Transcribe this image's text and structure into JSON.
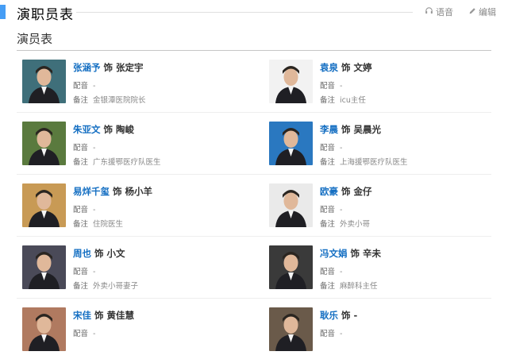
{
  "section": {
    "title": "演职员表",
    "voice_label": "语音",
    "edit_label": "编辑"
  },
  "cast_table": {
    "title": "演员表",
    "dub_label": "配音",
    "note_label": "备注",
    "role_connector": "饰",
    "items": [
      {
        "actor": "张涵予",
        "role": "张定宇",
        "dub": "-",
        "note": "金银潭医院院长",
        "photo_bg": "#3f6f7a"
      },
      {
        "actor": "袁泉",
        "role": "文婷",
        "dub": "-",
        "note": "icu主任",
        "photo_bg": "#f2f2f2"
      },
      {
        "actor": "朱亚文",
        "role": "陶峻",
        "dub": "-",
        "note": "广东援鄂医疗队医生",
        "photo_bg": "#5a7a3e"
      },
      {
        "actor": "李晨",
        "role": "吴晨光",
        "dub": "-",
        "note": "上海援鄂医疗队医生",
        "photo_bg": "#2a78c0"
      },
      {
        "actor": "易烊千玺",
        "role": "杨小羊",
        "dub": "-",
        "note": "住院医生",
        "photo_bg": "#c89a55"
      },
      {
        "actor": "欧豪",
        "role": "金仔",
        "dub": "-",
        "note": "外卖小哥",
        "photo_bg": "#eaeaea"
      },
      {
        "actor": "周也",
        "role": "小文",
        "dub": "-",
        "note": "外卖小哥妻子",
        "photo_bg": "#4a4a58"
      },
      {
        "actor": "冯文娟",
        "role": "辛未",
        "dub": "-",
        "note": "麻醉科主任",
        "photo_bg": "#3a3a3a"
      },
      {
        "actor": "宋佳",
        "role": "黄佳慧",
        "dub": "-",
        "note": "",
        "photo_bg": "#b07a60"
      },
      {
        "actor": "耿乐",
        "role": "-",
        "dub": "-",
        "note": "",
        "photo_bg": "#6a5a4a"
      }
    ]
  }
}
